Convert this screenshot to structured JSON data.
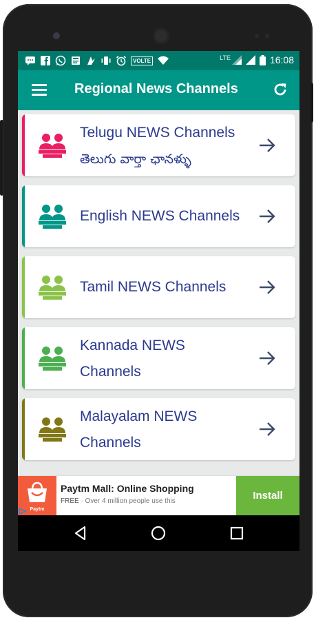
{
  "status_bar": {
    "time": "16:08",
    "lte": "LTE",
    "volte": "VOLTE",
    "icons": [
      "messages-icon",
      "facebook-icon",
      "whatsapp-icon",
      "news-icon",
      "app-icon",
      "vibrate-icon",
      "alarm-icon",
      "volte-icon",
      "wifi-icon",
      "signal-icon",
      "signal-icon",
      "battery-icon"
    ]
  },
  "app_bar": {
    "title": "Regional News Channels",
    "menu_icon": "menu-icon",
    "refresh_icon": "refresh-icon"
  },
  "channels": [
    {
      "line1": "Telugu NEWS Channels",
      "line2": "తెలుగు వార్తా ఛానళ్ళు",
      "color": "#e91e63"
    },
    {
      "line1": "English NEWS Channels",
      "line2": "",
      "color": "#009688"
    },
    {
      "line1": "Tamil NEWS Channels",
      "line2": "",
      "color": "#8bc34a"
    },
    {
      "line1": "Kannada NEWS",
      "line2": "Channels",
      "color": "#4caf50"
    },
    {
      "line1": "Malayalam NEWS",
      "line2": "Channels",
      "color": "#827717"
    }
  ],
  "ad": {
    "title": "Paytm Mall: Online Shopping",
    "free": "FREE",
    "subtitle": " · Over 4 million people use this",
    "install": "Install",
    "brand": "Paytm",
    "logo_color": "#f25c3c",
    "install_color": "#6bb73e"
  },
  "nav_bar": {
    "icons": [
      "back-icon",
      "home-icon",
      "recents-icon"
    ]
  },
  "colors": {
    "primary": "#009688",
    "primary_dark": "#00796b",
    "text": "#2a3a8f",
    "arrow": "#3c4b6a"
  }
}
